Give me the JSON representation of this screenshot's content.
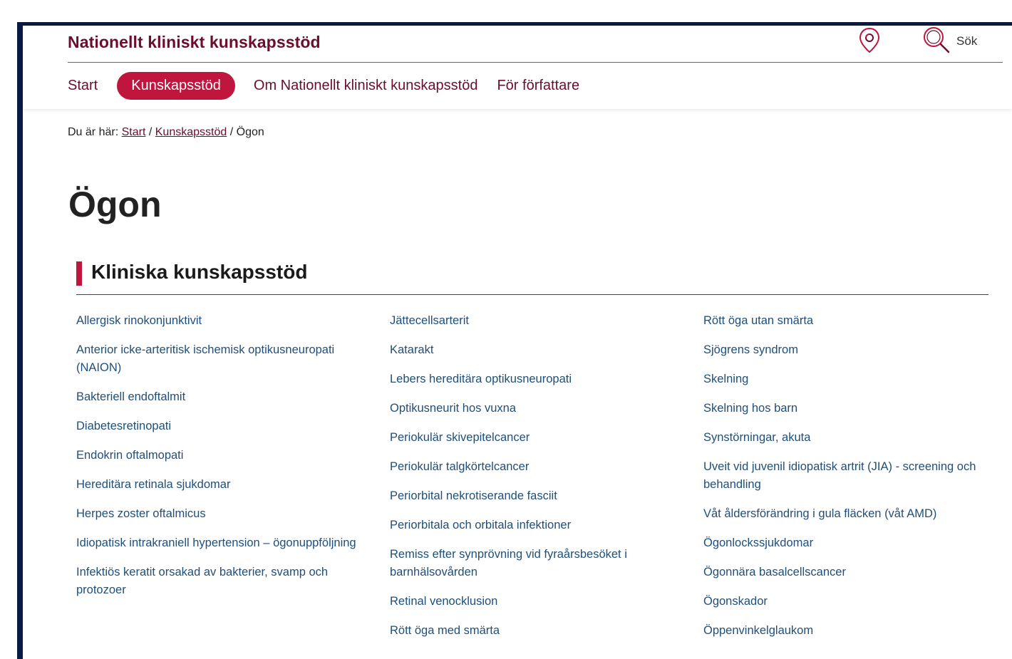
{
  "header": {
    "site_title": "Nationellt kliniskt kunskapsstöd",
    "search_label": "Sök",
    "nav": [
      {
        "label": "Start",
        "active": false
      },
      {
        "label": "Kunskapsstöd",
        "active": true
      },
      {
        "label": "Om Nationellt kliniskt kunskapsstöd",
        "active": false
      },
      {
        "label": "För författare",
        "active": false
      }
    ]
  },
  "breadcrumb": {
    "prefix": "Du är här:",
    "items": [
      "Start",
      "Kunskapsstöd"
    ],
    "separator": "/",
    "current": "Ögon"
  },
  "page": {
    "title": "Ögon",
    "section_title": "Kliniska kunskapsstöd"
  },
  "links": {
    "col1": [
      "Allergisk rinokonjunktivit",
      "Anterior icke-arteritisk ischemisk optikusneuropati (NAION)",
      "Bakteriell endoftalmit",
      "Diabetesretinopati",
      "Endokrin oftalmopati",
      "Hereditära retinala sjukdomar",
      "Herpes zoster oftalmicus",
      "Idiopatisk intrakraniell hypertension – ögonuppföljning",
      "Infektiös keratit orsakad av bakterier, svamp och protozoer"
    ],
    "col2": [
      "Jättecellsarterit",
      "Katarakt",
      "Lebers hereditära optikusneuropati",
      "Optikusneurit hos vuxna",
      "Periokulär skivepitelcancer",
      "Periokulär talgkörtelcancer",
      "Periorbital nekrotiserande fasciit",
      "Periorbitala och orbitala infektioner",
      "Remiss efter synprövning vid fyraårsbesöket i barnhälsovården",
      "Retinal venocklusion",
      "Rött öga med smärta"
    ],
    "col3": [
      "Rött öga utan smärta",
      "Sjögrens syndrom",
      "Skelning",
      "Skelning hos barn",
      "Synstörningar, akuta",
      "Uveit vid juvenil idiopatisk artrit (JIA) - screening och behandling",
      "Våt åldersförändring i gula fläcken (våt AMD)",
      "Ögonlockssjukdomar",
      "Ögonnära basalcellscancer",
      "Ögonskador",
      "Öppenvinkelglaukom"
    ]
  },
  "colors": {
    "brand_dark": "#6b0d2c",
    "brand_accent": "#c0163e",
    "link": "#1f4f7a",
    "frame": "#0a1a46"
  },
  "icons": {
    "location": "map-pin-icon",
    "search": "search-icon"
  }
}
